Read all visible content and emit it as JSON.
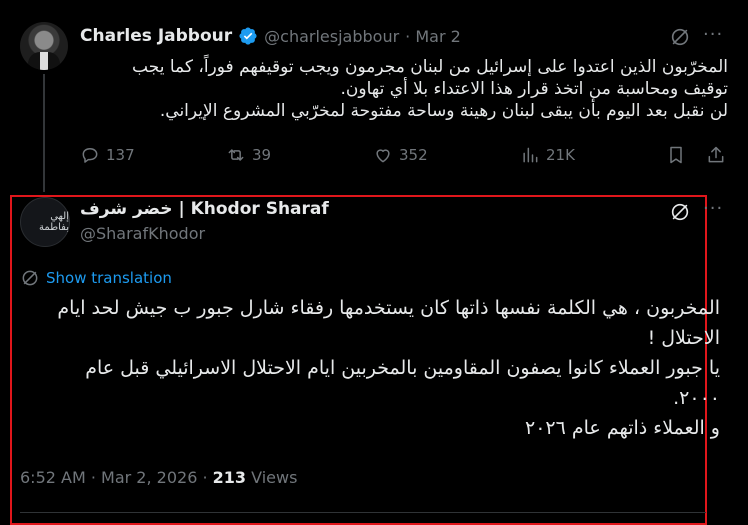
{
  "tweet1": {
    "name": "Charles Jabbour",
    "handle": "@charlesjabbour",
    "date": "· Mar 2",
    "text_lines": [
      "المخرّبون الذين اعتدوا على إسرائيل من لبنان مجرمون ويجب توقيفهم فوراً، كما يجب",
      "توقيف ومحاسبة من اتخذ قرار هذا الاعتداء بلا أي تهاون.",
      "لن نقبل بعد اليوم بأن يبقى لبنان رهينة وساحة مفتوحة لمخرّبي المشروع الإيراني."
    ],
    "replies": "137",
    "reposts": "39",
    "likes": "352",
    "views": "21K"
  },
  "tweet2": {
    "name": "خضر شرف | Khodor Sharaf",
    "handle": "@SharafKhodor",
    "avatar_text": "إلهي بفاطمة",
    "show_translation": "Show translation",
    "text_lines": [
      "المخربون ، هي الكلمة نفسها ذاتها كان يستخدمها رفقاء شارل جبور ب جيش لحد ايام",
      "الاحتلال !",
      "يا جبور العملاء كانوا يصفون المقاومين بالمخربين ايام الاحتلال الاسرائيلي قبل عام",
      "٢٠٠٠.",
      "و العملاء ذاتهم عام ٢٠٢٦"
    ],
    "timestamp": "6:52 AM · Mar 2, 2026 · ",
    "views_count": "213",
    "views_label": " Views"
  },
  "colors": {
    "accent": "#1d9bf0",
    "highlight_box": "#e0161b",
    "muted": "#71767b"
  },
  "icons": [
    "grok-icon",
    "more-icon",
    "reply-icon",
    "repost-icon",
    "like-icon",
    "views-icon",
    "bookmark-icon",
    "share-icon",
    "verified-badge-icon",
    "translate-icon"
  ]
}
